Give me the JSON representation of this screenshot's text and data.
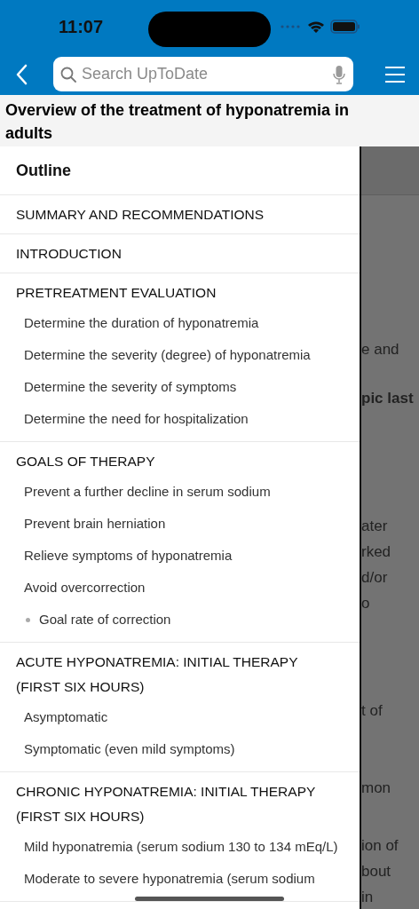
{
  "status_bar": {
    "time": "11:07"
  },
  "nav": {
    "search": {
      "placeholder": "Search UpToDate"
    }
  },
  "title": "Overview of the treatment of hyponatremia in adults",
  "outline": {
    "heading": "Outline",
    "sections": [
      {
        "label": "SUMMARY AND RECOMMENDATIONS"
      },
      {
        "label": "INTRODUCTION"
      },
      {
        "label": "PRETREATMENT EVALUATION",
        "children": [
          {
            "label": "Determine the duration of hyponatremia"
          },
          {
            "label": "Determine the severity (degree) of hyponatremia"
          },
          {
            "label": "Determine the severity of symptoms"
          },
          {
            "label": "Determine the need for hospitalization"
          }
        ]
      },
      {
        "label": "GOALS OF THERAPY",
        "children": [
          {
            "label": "Prevent a further decline in serum sodium"
          },
          {
            "label": "Prevent brain herniation"
          },
          {
            "label": "Relieve symptoms of hyponatremia"
          },
          {
            "label": "Avoid overcorrection",
            "children": [
              {
                "label": "Goal rate of correction"
              }
            ]
          }
        ]
      },
      {
        "label": "ACUTE HYPONATREMIA: INITIAL THERAPY (FIRST SIX HOURS)",
        "children": [
          {
            "label": "Asymptomatic"
          },
          {
            "label": "Symptomatic (even mild symptoms)"
          }
        ]
      },
      {
        "label": "CHRONIC HYPONATREMIA: INITIAL THERAPY (FIRST SIX HOURS)",
        "children": [
          {
            "label": "Mild hyponatremia (serum sodium 130 to 134 mEq/L)"
          },
          {
            "label": "Moderate to severe hyponatremia (serum sodium"
          }
        ]
      }
    ]
  },
  "article_fragments": [
    {
      "text": "e and",
      "bold": false
    },
    {
      "text": "pic last",
      "bold": true
    },
    {
      "text": "ater",
      "bold": false
    },
    {
      "text": "rked",
      "bold": false
    },
    {
      "text": "d/or",
      "bold": false
    },
    {
      "text": "o",
      "bold": false
    },
    {
      "text": "t of",
      "bold": false
    },
    {
      "text": "mon",
      "bold": false
    },
    {
      "text": "ion of",
      "bold": false
    },
    {
      "text": "bout",
      "bold": false
    },
    {
      "text": "in",
      "bold": false
    }
  ]
}
